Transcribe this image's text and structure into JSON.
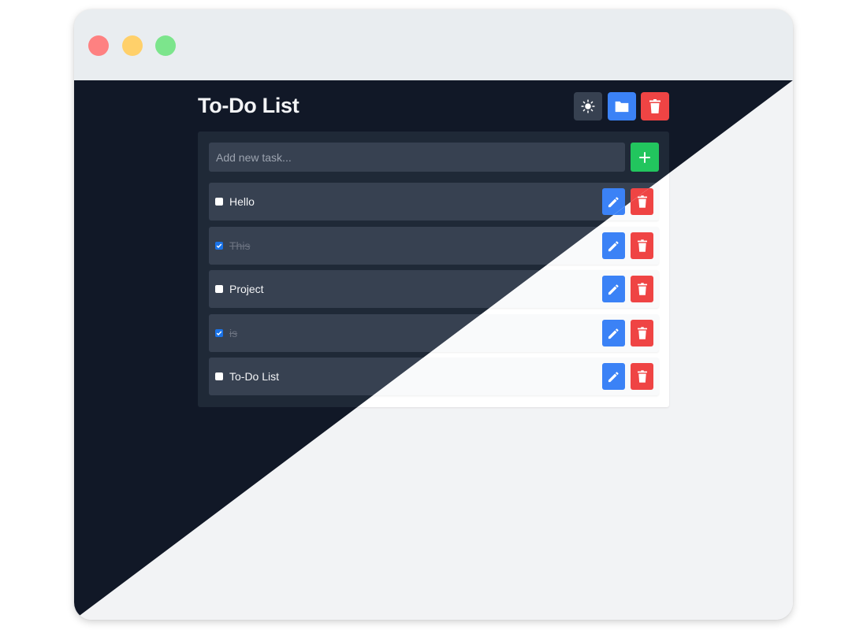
{
  "app": {
    "title": "To-Do List",
    "add_placeholder": "Add new task...",
    "header_buttons": [
      {
        "name": "theme-toggle",
        "icon": "sun-icon"
      },
      {
        "name": "folder",
        "icon": "folder-icon"
      },
      {
        "name": "clear-all",
        "icon": "trash-icon"
      }
    ],
    "add_button_icon": "plus-icon"
  },
  "tasks": [
    {
      "label": "Hello",
      "done": false
    },
    {
      "label": "This",
      "done": true
    },
    {
      "label": "Project",
      "done": false
    },
    {
      "label": "is",
      "done": true
    },
    {
      "label": "To-Do List",
      "done": false
    }
  ],
  "colors": {
    "dark_bg": "#111827",
    "light_bg": "#f2f3f5",
    "accent_blue": "#3b82f6",
    "danger_red": "#ef4444",
    "success_green": "#22c55e"
  }
}
